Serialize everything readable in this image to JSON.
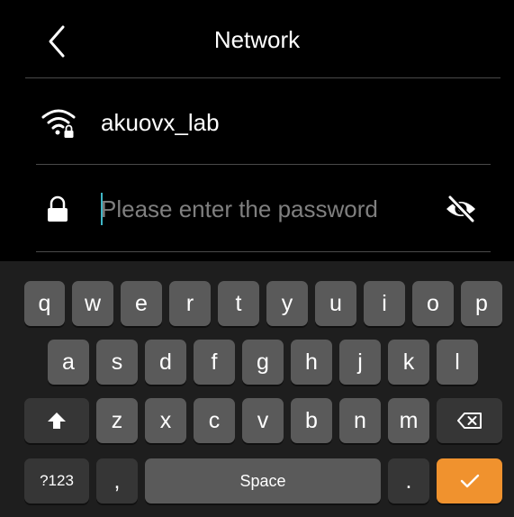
{
  "header": {
    "title": "Network"
  },
  "network": {
    "ssid": "akuovx_lab"
  },
  "password": {
    "placeholder": "Please enter the password",
    "value": ""
  },
  "keyboard": {
    "row1": [
      "q",
      "w",
      "e",
      "r",
      "t",
      "y",
      "u",
      "i",
      "o",
      "p"
    ],
    "row2": [
      "a",
      "s",
      "d",
      "f",
      "g",
      "h",
      "j",
      "k",
      "l"
    ],
    "row3": [
      "z",
      "x",
      "c",
      "v",
      "b",
      "n",
      "m"
    ],
    "symbols_label": "?123",
    "comma_label": ",",
    "space_label": "Space",
    "period_label": "."
  },
  "icons": {
    "back": "chevron-left-icon",
    "wifi": "wifi-locked-icon",
    "lock": "lock-icon",
    "visibility": "eye-off-icon",
    "shift": "shift-arrow-icon",
    "backspace": "backspace-icon",
    "done": "checkmark-icon"
  },
  "colors": {
    "background": "#000000",
    "keyboard_bg": "#1e1e1e",
    "key": "#5a5a5a",
    "key_dark": "#363636",
    "accent": "#f0922e",
    "cursor": "#3fb6c6",
    "placeholder": "#7f7f7f"
  }
}
